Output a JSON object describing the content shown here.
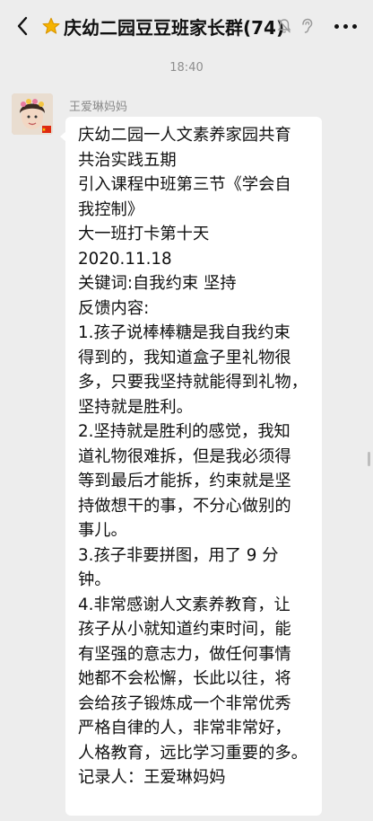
{
  "header": {
    "title": "庆幼二园豆豆班家长群(74)",
    "back_icon": "chevron-left-icon",
    "star_icon": "star-icon",
    "more_icon": "more-dots-icon"
  },
  "chat": {
    "timestamp": "18:40",
    "message": {
      "sender": "王爱琳妈妈",
      "lines": [
        "庆幼二园一人文素养家园共育",
        "共治实践五期",
        "引入课程中班第三节《学会自",
        "我控制》",
        "大一班打卡第十天",
        "2020.11.18",
        "关键词:自我约束   坚持",
        "反馈内容:",
        "1.孩子说棒棒糖是我自我约束",
        "得到的，我知道盒子里礼物很",
        "多，只要我坚持就能得到礼物，",
        "坚持就是胜利。",
        "2.坚持就是胜利的感觉，我知",
        "道礼物很难拆，但是我必须得",
        "等到最后才能拆，约束就是坚",
        "持做想干的事，不分心做别的",
        "事儿。",
        "3.孩子非要拼图，用了 9 分",
        "钟。",
        "4.非常感谢人文素养教育，让",
        "孩子从小就知道约束时间，能",
        "有坚强的意志力，做任何事情",
        "她都不会松懈，长此以往，将",
        "会给孩子锻炼成一个非常优秀",
        "严格自律的人，非常非常好，",
        "人格教育，远比学习重要的多。",
        "记录人：王爱琳妈妈"
      ]
    }
  },
  "colors": {
    "background": "#ededed",
    "bubble": "#ffffff",
    "star": "#f5b301",
    "secondary_text": "#8e8e8e"
  }
}
